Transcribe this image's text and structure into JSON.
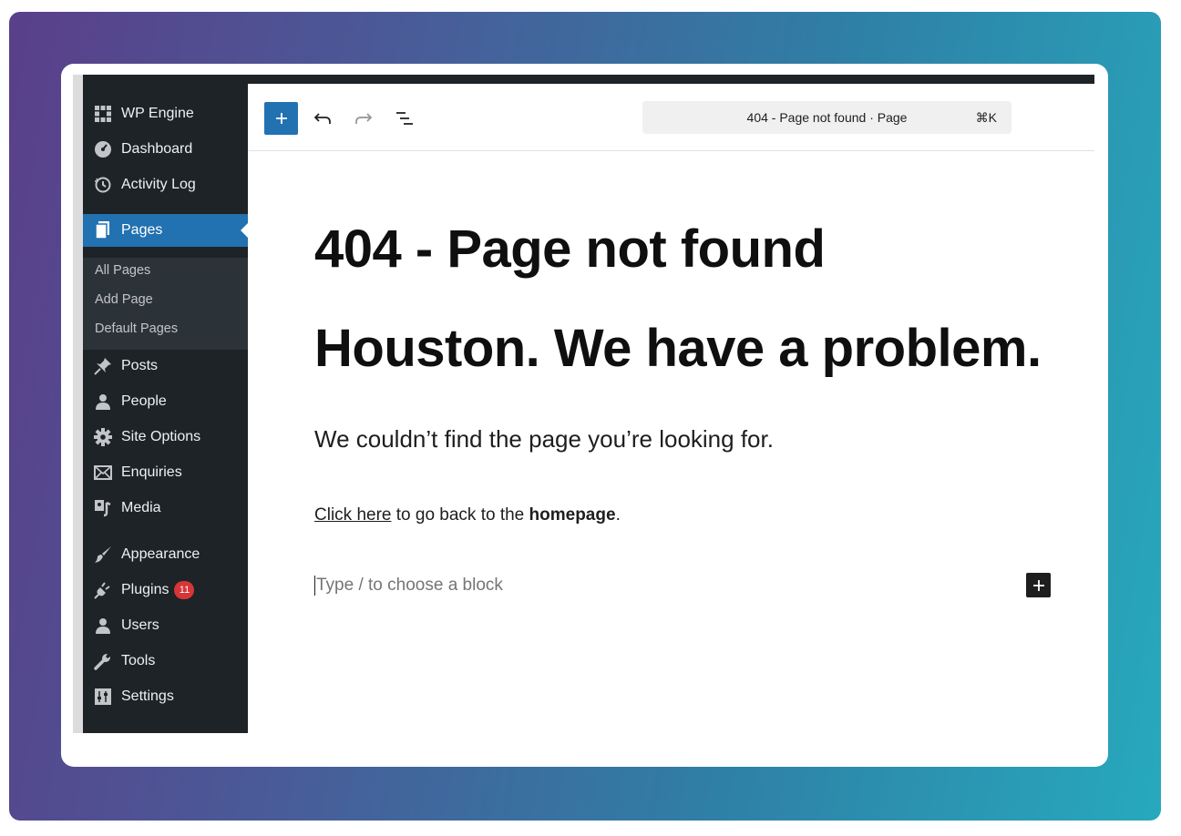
{
  "sidebar": {
    "items": [
      {
        "label": "WP Engine",
        "icon": "wp-engine-grid-icon"
      },
      {
        "label": "Dashboard",
        "icon": "dashboard-gauge-icon"
      },
      {
        "label": "Activity Log",
        "icon": "history-clock-icon"
      },
      {
        "label": "Pages",
        "icon": "pages-icon",
        "active": true
      },
      {
        "label": "Posts",
        "icon": "pin-icon"
      },
      {
        "label": "People",
        "icon": "person-icon"
      },
      {
        "label": "Site Options",
        "icon": "gear-icon"
      },
      {
        "label": "Enquiries",
        "icon": "envelope-icon"
      },
      {
        "label": "Media",
        "icon": "media-icon"
      },
      {
        "label": "Appearance",
        "icon": "paintbrush-icon"
      },
      {
        "label": "Plugins",
        "icon": "plug-icon",
        "badge": "11"
      },
      {
        "label": "Users",
        "icon": "person-icon"
      },
      {
        "label": "Tools",
        "icon": "wrench-icon"
      },
      {
        "label": "Settings",
        "icon": "sliders-icon"
      }
    ],
    "submenu": [
      "All Pages",
      "Add Page",
      "Default Pages"
    ]
  },
  "toolbar": {
    "add_block": "+",
    "command_title": "404 - Page not found · Page",
    "command_shortcut": "⌘K"
  },
  "content": {
    "heading_1": "404 - Page not found",
    "heading_2": "Houston. We have a problem.",
    "paragraph": "We couldn’t find the page you’re looking for.",
    "link_text": "Click here",
    "link_middle": " to go back to the ",
    "link_bold": "homepage",
    "link_end": ".",
    "placeholder": "Type / to choose a block"
  },
  "colors": {
    "sidebar_bg": "#1d2327",
    "active_item": "#2271b1",
    "badge": "#d63638"
  }
}
